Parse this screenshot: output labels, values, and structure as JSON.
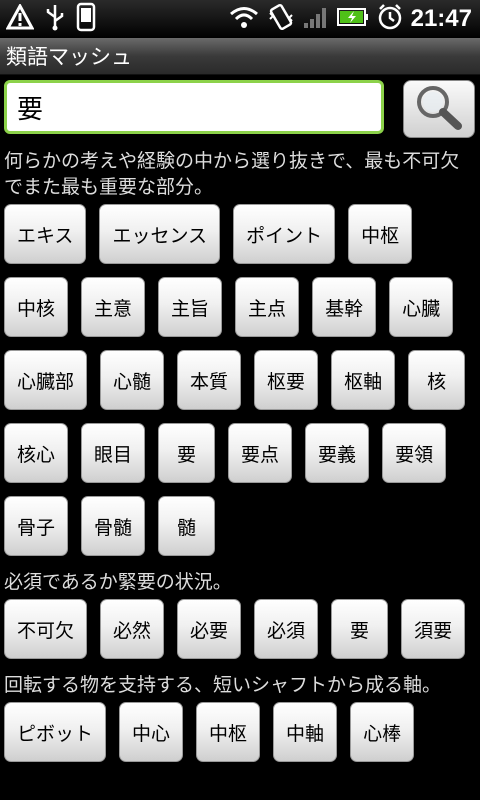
{
  "status_bar": {
    "time": "21:47",
    "icons": [
      "alert-icon",
      "usb-icon",
      "phone-icon",
      "wifi-icon",
      "vibrate-icon",
      "signal-icon",
      "battery-charging-icon",
      "alarm-icon"
    ]
  },
  "app": {
    "title": "類語マッシュ"
  },
  "search": {
    "value": "要"
  },
  "groups": [
    {
      "definition": "何らかの考えや経験の中から選り抜きで、最も不可欠でまた最も重要な部分。",
      "words": [
        "エキス",
        "エッセンス",
        "ポイント",
        "中枢",
        "中核",
        "主意",
        "主旨",
        "主点",
        "基幹",
        "心臓",
        "心臓部",
        "心髄",
        "本質",
        "枢要",
        "枢軸",
        "核",
        "核心",
        "眼目",
        "要",
        "要点",
        "要義",
        "要領",
        "骨子",
        "骨髄",
        "髄"
      ]
    },
    {
      "definition": "必須であるか緊要の状況。",
      "words": [
        "不可欠",
        "必然",
        "必要",
        "必須",
        "要",
        "須要"
      ]
    },
    {
      "definition": "回転する物を支持する、短いシャフトから成る軸。",
      "words": [
        "ピボット",
        "中心",
        "中枢",
        "中軸",
        "心棒"
      ]
    }
  ],
  "colors": {
    "input_border": "#8cd24a",
    "background": "#000000"
  }
}
